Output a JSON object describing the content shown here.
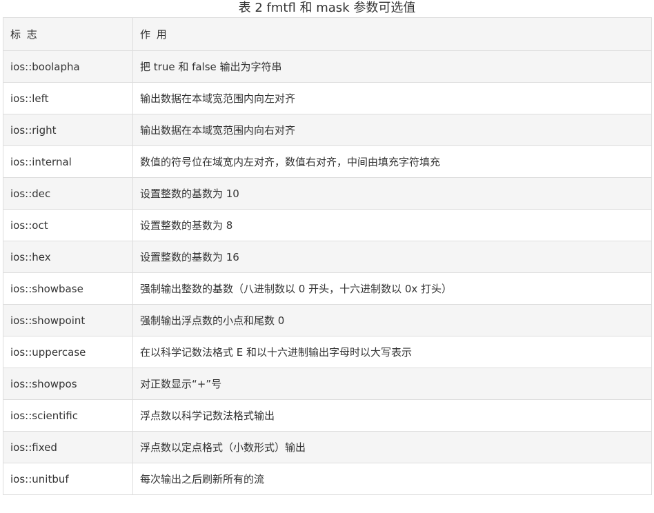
{
  "caption": "表 2 fmtfl 和 mask 参数可选值",
  "table": {
    "headers": [
      "标 志",
      "作 用"
    ],
    "rows": [
      {
        "flag": "ios::boolapha",
        "desc": "把 true 和 false 输出为字符串"
      },
      {
        "flag": "ios::left",
        "desc": "输出数据在本域宽范围内向左对齐"
      },
      {
        "flag": "ios::right",
        "desc": "输出数据在本域宽范围内向右对齐"
      },
      {
        "flag": "ios::internal",
        "desc": "数值的符号位在域宽内左对齐，数值右对齐，中间由填充字符填充"
      },
      {
        "flag": "ios::dec",
        "desc": "设置整数的基数为 10"
      },
      {
        "flag": "ios::oct",
        "desc": "设置整数的基数为 8"
      },
      {
        "flag": "ios::hex",
        "desc": "设置整数的基数为 16"
      },
      {
        "flag": "ios::showbase",
        "desc": "强制输出整数的基数（八进制数以 0 开头，十六进制数以 0x 打头）"
      },
      {
        "flag": "ios::showpoint",
        "desc": "强制输出浮点数的小点和尾数 0"
      },
      {
        "flag": "ios::uppercase",
        "desc": "在以科学记数法格式 E 和以十六进制输出字母时以大写表示"
      },
      {
        "flag": "ios::showpos",
        "desc": "对正数显示“+”号"
      },
      {
        "flag": "ios::scientific",
        "desc": "浮点数以科学记数法格式输出"
      },
      {
        "flag": "ios::fixed",
        "desc": "浮点数以定点格式（小数形式）输出"
      },
      {
        "flag": "ios::unitbuf",
        "desc": "每次输出之后刷新所有的流"
      }
    ]
  }
}
